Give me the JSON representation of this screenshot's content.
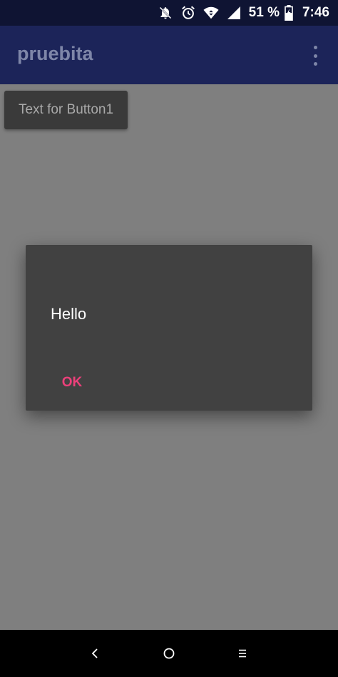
{
  "status_bar": {
    "icons": [
      "notifications-off-icon",
      "alarm-icon",
      "wifi-data-icon",
      "cell-signal-icon",
      "battery-charging-icon"
    ],
    "battery_text": "51 %",
    "time": "7:46"
  },
  "app_bar": {
    "title": "pruebita",
    "menu_icon": "more-vert-icon"
  },
  "content": {
    "button_label": "Text for Button1"
  },
  "dialog": {
    "message": "Hello",
    "ok_label": "OK"
  },
  "nav_bar": {
    "icons": [
      "back-icon",
      "home-icon",
      "recents-icon"
    ]
  },
  "colors": {
    "status_bar": "#0f1433",
    "app_bar": "#1c2459",
    "scrim_background": "#7f7f7f",
    "dialog_background": "#414141",
    "accent": "#ec407a",
    "nav_bar": "#000000"
  }
}
